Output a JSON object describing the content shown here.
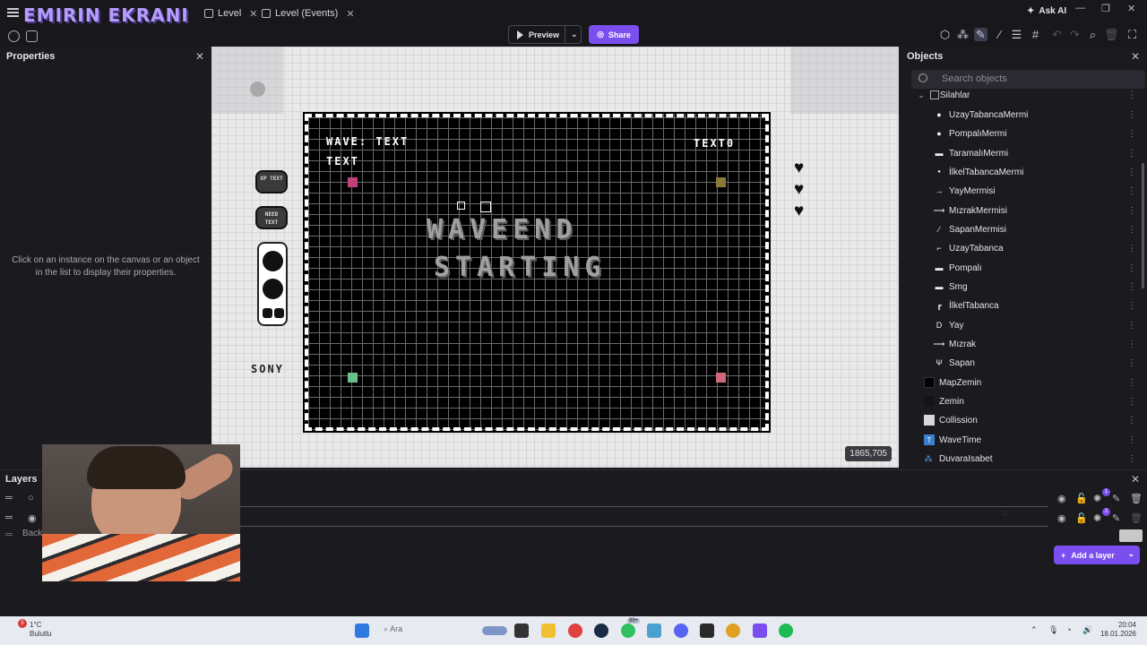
{
  "window": {
    "brand": "EMIRIN EKRANI",
    "tabs": [
      {
        "label": "Level"
      },
      {
        "label": "Level (Events)"
      }
    ],
    "ask_ai": "Ask AI"
  },
  "toolbar": {
    "preview_label": "Preview",
    "share_label": "Share"
  },
  "properties": {
    "title": "Properties",
    "hint": "Click on an instance on the canvas or an object in the list to display their properties."
  },
  "canvas": {
    "game_texts": {
      "wave": "WAVE: TEXT",
      "text": "TEXT",
      "right_text": "TEXT0",
      "big_line1": "WAVEEND",
      "big_line2": "STARTING",
      "sony": "SONY",
      "btn1": "XP TEXT",
      "btn2": "NEED TEXT"
    },
    "coord_readout": "1865,705",
    "colors": {
      "pink": "#c2407a",
      "olive": "#8a7a3a",
      "green": "#6ac08a",
      "salmon": "#d06a7a"
    }
  },
  "objects": {
    "title": "Objects",
    "search_placeholder": "Search objects",
    "items": [
      {
        "label": "Silahlar",
        "icon": "folder-icon"
      },
      {
        "label": "UzayTabancaMermi",
        "icon": "dot-icon"
      },
      {
        "label": "PompalıMermi",
        "icon": "dot-icon"
      },
      {
        "label": "TaramalıMermi",
        "icon": "dash-icon"
      },
      {
        "label": "İlkelTabancaMermi",
        "icon": "small-dot-icon"
      },
      {
        "label": "YayMermisi",
        "icon": "arrow-icon"
      },
      {
        "label": "MızrakMermisi",
        "icon": "spear-icon"
      },
      {
        "label": "SapanMermisi",
        "icon": "slash-icon"
      },
      {
        "label": "UzayTabanca",
        "icon": "gun-icon"
      },
      {
        "label": "Pompalı",
        "icon": "shotgun-icon"
      },
      {
        "label": "Smg",
        "icon": "smg-icon"
      },
      {
        "label": "İlkelTabanca",
        "icon": "pistol-icon"
      },
      {
        "label": "Yay",
        "icon": "bow-icon"
      },
      {
        "label": "Mızrak",
        "icon": "spear-icon"
      },
      {
        "label": "Sapan",
        "icon": "slingshot-icon"
      },
      {
        "label": "MapZemin",
        "icon": "black-square-icon"
      },
      {
        "label": "Zemin",
        "icon": "dark-square-icon"
      },
      {
        "label": "Collission",
        "icon": "white-square-icon"
      },
      {
        "label": "WaveTime",
        "icon": "text-object-icon"
      },
      {
        "label": "DuvaraIsabet",
        "icon": "particle-icon"
      }
    ]
  },
  "layers": {
    "title": "Layers",
    "row3_label": "Back",
    "badge1": "1",
    "badge2": "2",
    "add_layer_label": "Add a layer"
  },
  "taskbar": {
    "weather_temp": "1°C",
    "weather_desc": "Bulutlu",
    "notif_count": "5",
    "search_text": "Ara",
    "time": "20:04",
    "date": "18.01.2026",
    "badge_99": "99+"
  }
}
